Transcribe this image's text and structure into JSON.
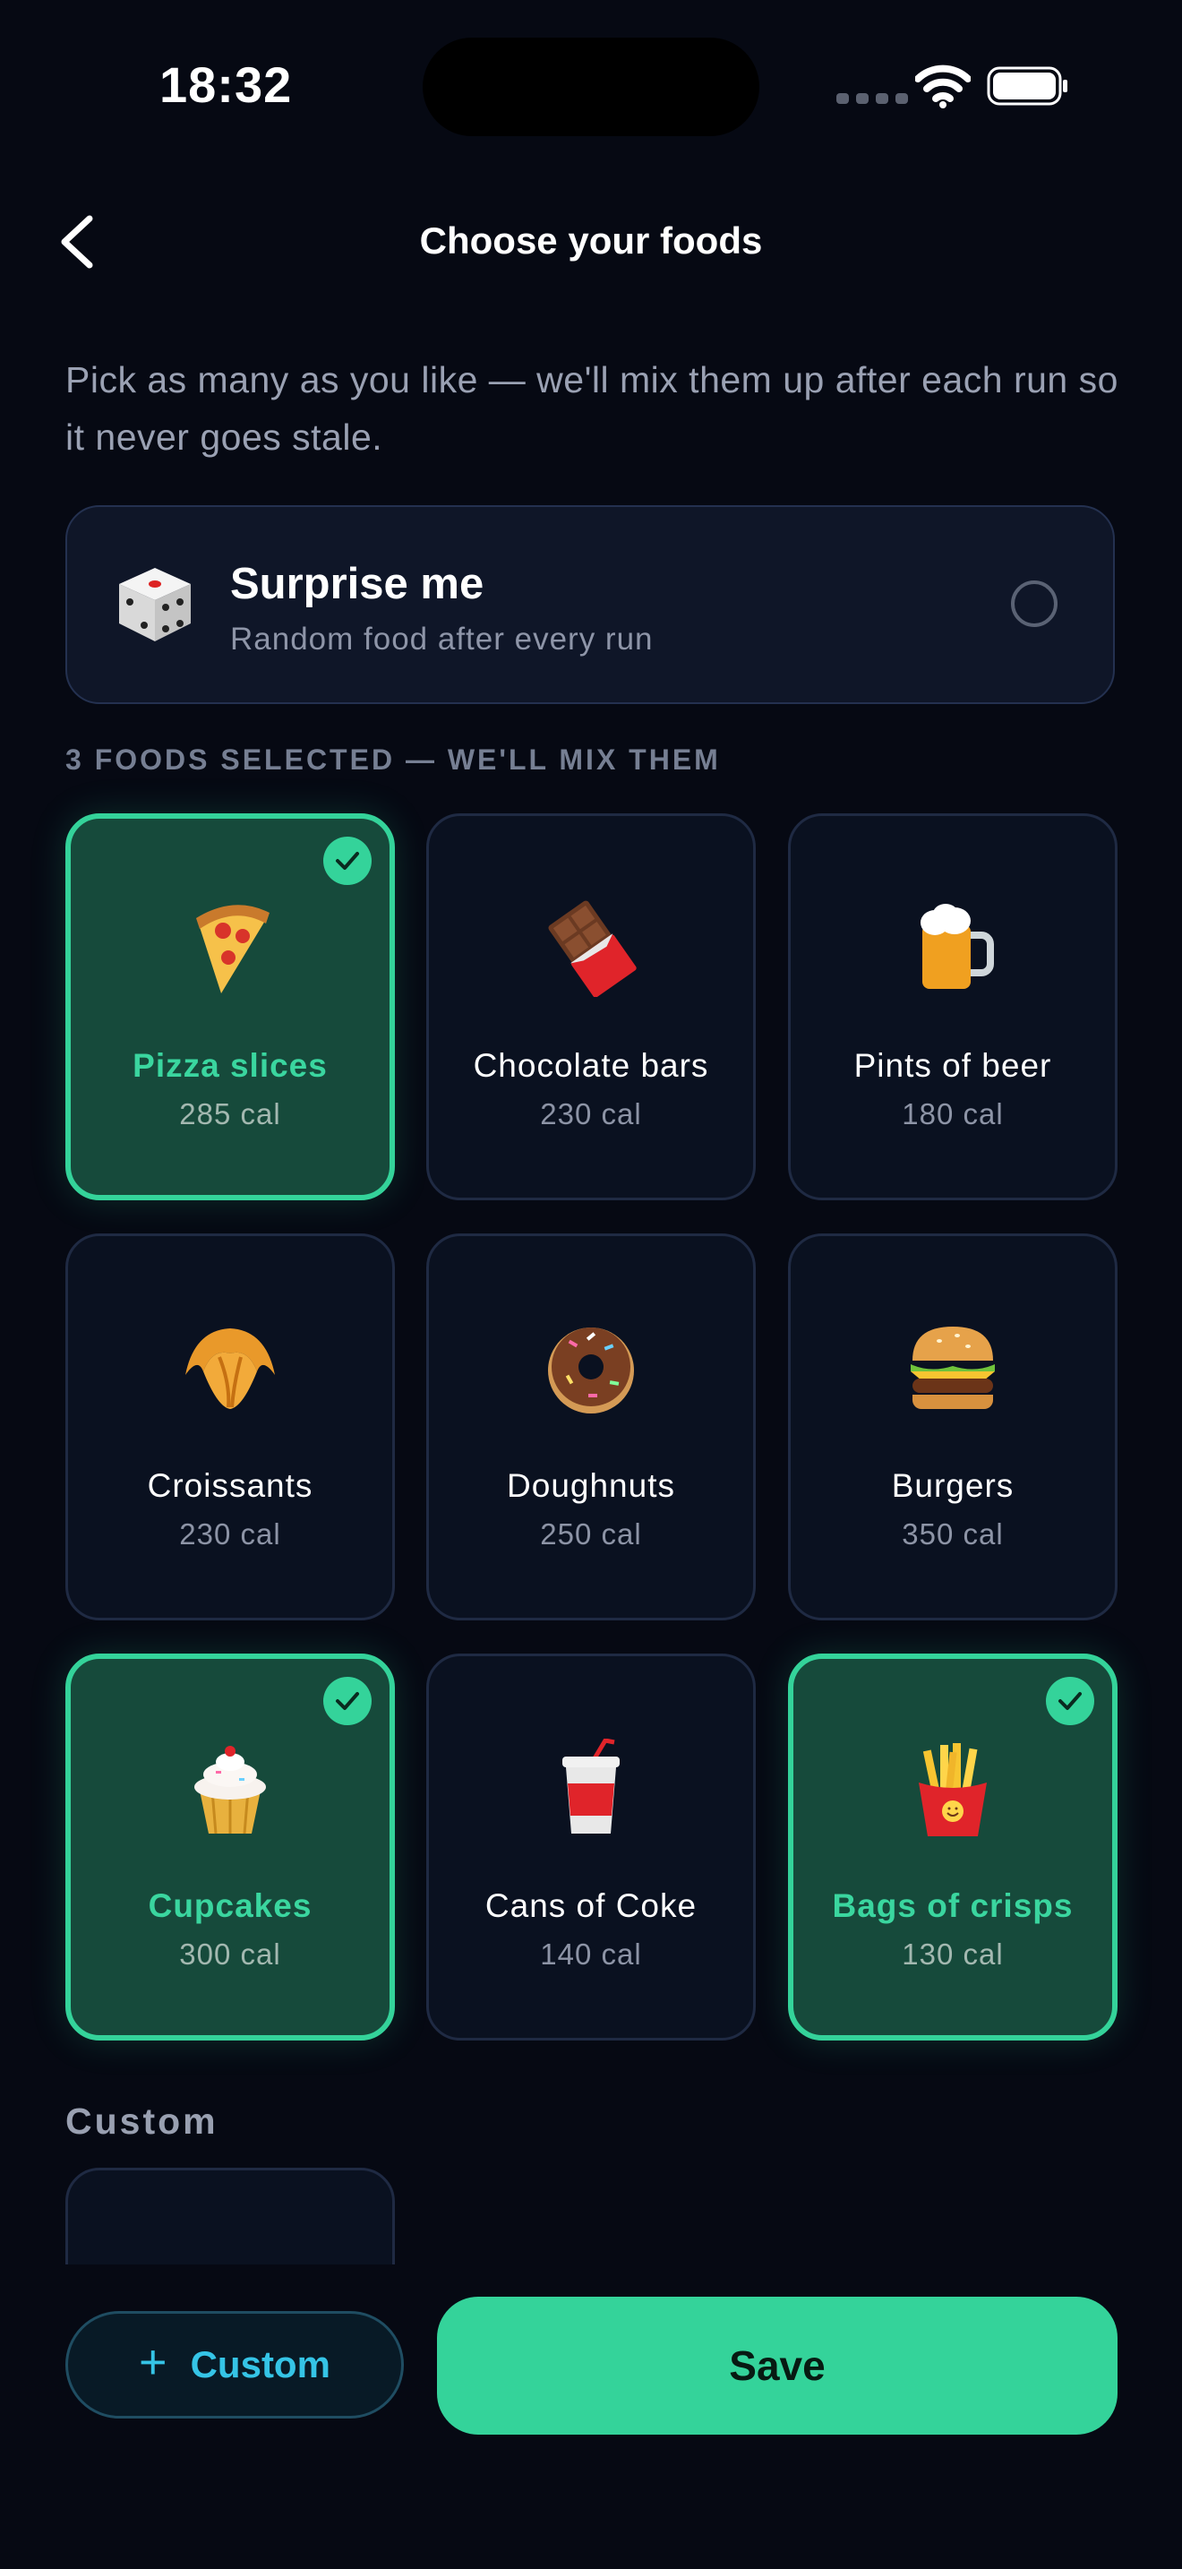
{
  "status": {
    "time": "18:32"
  },
  "header": {
    "title": "Choose your foods"
  },
  "intro": "Pick as many as you like — we'll mix them up after each run so it never goes stale.",
  "surprise": {
    "title": "Surprise me",
    "subtitle": "Random food after every run",
    "checked": false
  },
  "selection_label": "3 FOODS SELECTED — WE'LL MIX THEM",
  "foods": [
    {
      "name": "Pizza slices",
      "cal": "285 cal",
      "icon": "pizza-icon",
      "selected": true
    },
    {
      "name": "Chocolate bars",
      "cal": "230 cal",
      "icon": "chocolate-bar-icon",
      "selected": false
    },
    {
      "name": "Pints of beer",
      "cal": "180 cal",
      "icon": "beer-mug-icon",
      "selected": false
    },
    {
      "name": "Croissants",
      "cal": "230 cal",
      "icon": "croissant-icon",
      "selected": false
    },
    {
      "name": "Doughnuts",
      "cal": "250 cal",
      "icon": "doughnut-icon",
      "selected": false
    },
    {
      "name": "Burgers",
      "cal": "350 cal",
      "icon": "burger-icon",
      "selected": false
    },
    {
      "name": "Cupcakes",
      "cal": "300 cal",
      "icon": "cupcake-icon",
      "selected": true
    },
    {
      "name": "Cans of Coke",
      "cal": "140 cal",
      "icon": "soda-cup-icon",
      "selected": false
    },
    {
      "name": "Bags of crisps",
      "cal": "130 cal",
      "icon": "fries-icon",
      "selected": true
    }
  ],
  "custom_section": {
    "label": "Custom"
  },
  "buttons": {
    "custom_label": "Custom",
    "save_label": "Save"
  },
  "colors": {
    "accent": "#34d39a",
    "background": "#060913",
    "card": "#0a1120",
    "custom_accent": "#35c4e6"
  }
}
